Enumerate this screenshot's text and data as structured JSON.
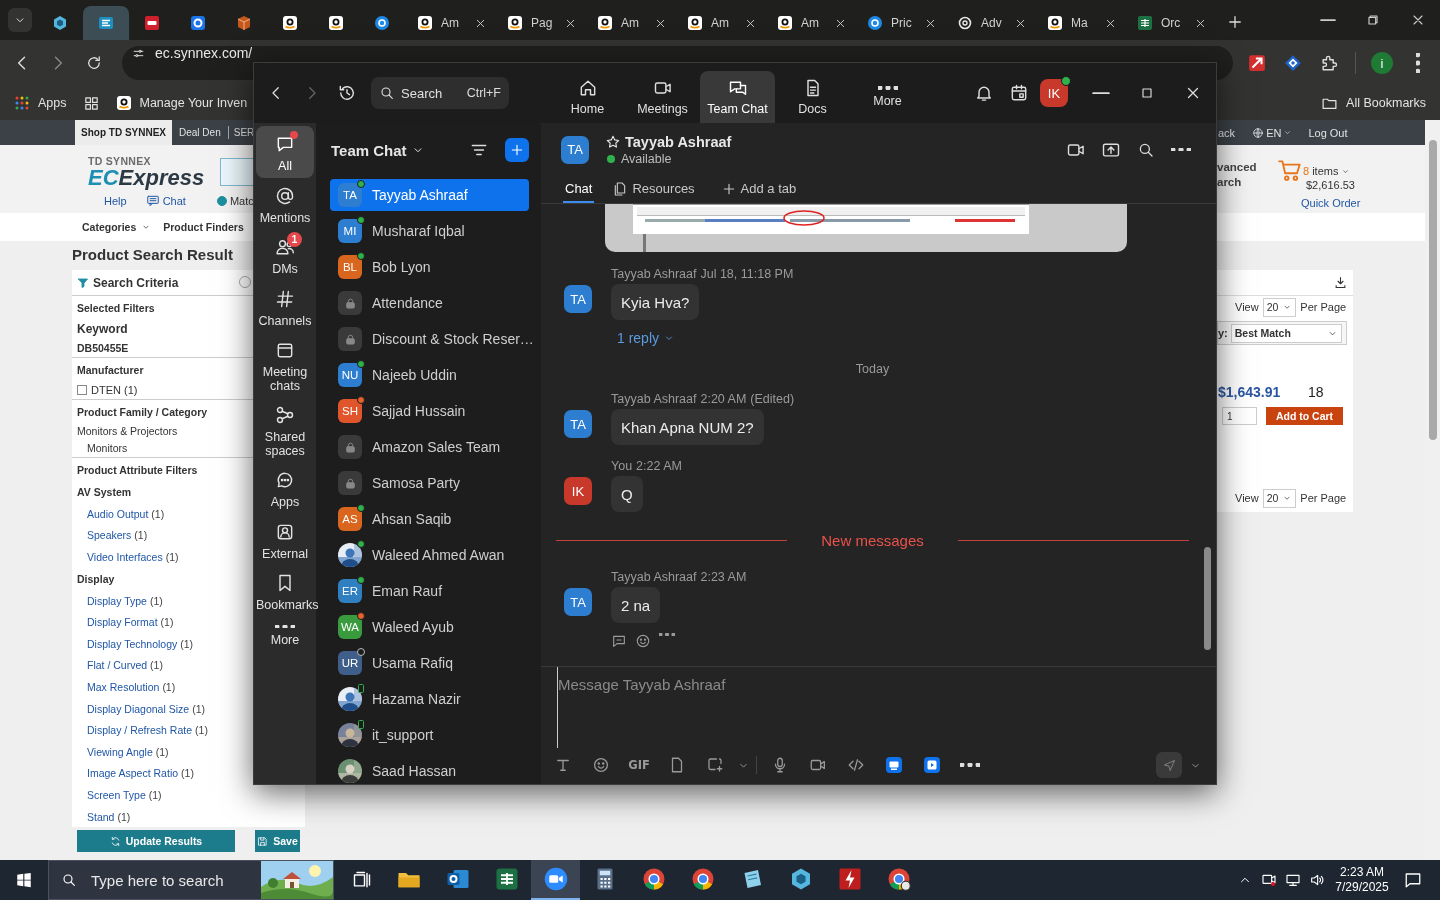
{
  "browser": {
    "tabs": [
      {
        "selected": false
      },
      {
        "selected": true
      },
      {
        "selected": false
      },
      {
        "selected": false
      },
      {
        "selected": false
      },
      {
        "selected": false
      },
      {
        "selected": false
      },
      {
        "selected": false
      },
      {
        "title": "Am",
        "selected": false
      },
      {
        "title": "Pag",
        "selected": false
      },
      {
        "title": "Am",
        "selected": false
      },
      {
        "title": "Am",
        "selected": false
      },
      {
        "title": "Am",
        "selected": false
      },
      {
        "title": "Pric",
        "selected": false
      },
      {
        "title": "Adv",
        "selected": false
      },
      {
        "title": "Ma",
        "selected": false
      },
      {
        "title": "Orc",
        "selected": false
      }
    ],
    "address": "ec.synnex.com/",
    "profile_initial": "i",
    "bookmarks": [
      {
        "kind": "apps",
        "label": "Apps"
      },
      {
        "kind": "grid"
      },
      {
        "kind": "site",
        "label": "Manage Your Inven"
      }
    ],
    "all_bookmarks": "All Bookmarks"
  },
  "web_page": {
    "top_nav": [
      {
        "label": "Shop TD SYNNEX",
        "selected": true
      },
      {
        "label": "Deal Den",
        "selected": false
      },
      {
        "label": "SER",
        "selected": false
      }
    ],
    "top_links": [
      {
        "kind": "text",
        "label": "ack"
      },
      {
        "kind": "language",
        "label": "EN"
      },
      {
        "kind": "text",
        "label": "Log Out"
      }
    ],
    "logo": {
      "small": "TD SYNNEX",
      "accent": "EC",
      "rest": "Express"
    },
    "header_links": [
      {
        "kind": "link",
        "label": "Help"
      },
      {
        "kind": "chat",
        "label": "Chat"
      },
      {
        "kind": "radio",
        "label": "Matc",
        "checked": true
      }
    ],
    "advanced": [
      "vanced",
      "arch"
    ],
    "cart": {
      "count": "8",
      "label": "items",
      "total": "$2,616.53",
      "quick_order": "Quick Order"
    },
    "nav": [
      {
        "kind": "dropdown",
        "label": "Categories"
      },
      {
        "kind": "link",
        "label": "Product Finders"
      }
    ],
    "title": "Product Search Result",
    "criteria": "Search Criteria",
    "filters": [
      {
        "kind": "section",
        "label": "Selected Filters"
      },
      {
        "kind": "heading",
        "label": "Keyword"
      },
      {
        "kind": "value",
        "label": "DB50455E"
      },
      {
        "kind": "section",
        "label": "Manufacturer"
      },
      {
        "kind": "checkbox",
        "label": "DTEN (1)",
        "checked": false
      },
      {
        "kind": "section",
        "label": "Product Family / Category"
      },
      {
        "kind": "text",
        "label": "Monitors & Projectors"
      },
      {
        "kind": "subtext",
        "label": "Monitors"
      },
      {
        "kind": "section",
        "label": "Product Attribute Filters"
      },
      {
        "kind": "group",
        "label": "AV System"
      },
      {
        "kind": "link",
        "label": "Audio Output",
        "count": "(1)"
      },
      {
        "kind": "link",
        "label": "Speakers",
        "count": "(1)"
      },
      {
        "kind": "link",
        "label": "Video Interfaces",
        "count": "(1)"
      },
      {
        "kind": "group",
        "label": "Display"
      },
      {
        "kind": "link",
        "label": "Display Type",
        "count": "(1)"
      },
      {
        "kind": "link",
        "label": "Display Format",
        "count": "(1)"
      },
      {
        "kind": "link",
        "label": "Display Technology",
        "count": "(1)"
      },
      {
        "kind": "link",
        "label": "Flat / Curved",
        "count": "(1)"
      },
      {
        "kind": "link",
        "label": "Max Resolution",
        "count": "(1)"
      },
      {
        "kind": "link",
        "label": "Display Diagonal Size",
        "count": "(1)"
      },
      {
        "kind": "link",
        "label": "Display / Refresh Rate",
        "count": "(1)"
      },
      {
        "kind": "link",
        "label": "Viewing Angle",
        "count": "(1)"
      },
      {
        "kind": "link",
        "label": "Image Aspect Ratio",
        "count": "(1)"
      },
      {
        "kind": "link",
        "label": "Screen Type",
        "count": "(1)"
      },
      {
        "kind": "link",
        "label": "Stand",
        "count": "(1)"
      }
    ],
    "buttons": [
      {
        "kind": "update",
        "label": "Update Results"
      },
      {
        "kind": "save",
        "label": "Save"
      }
    ],
    "results": {
      "view": {
        "label": "View",
        "value": "20",
        "suffix": "Per Page"
      },
      "sort": {
        "label": "y:",
        "value": "Best Match"
      },
      "price": "$1,643.91",
      "stock": "18",
      "quantity": "1",
      "add_to_cart": "Add to Cart",
      "view_bottom": {
        "label": "View",
        "value": "20",
        "suffix": "Per Page"
      }
    }
  },
  "zoom": {
    "search": {
      "placeholder": "Search",
      "shortcut": "Ctrl+F"
    },
    "nav": [
      {
        "label": "Home",
        "selected": false
      },
      {
        "label": "Meetings",
        "selected": false
      },
      {
        "label": "Team Chat",
        "selected": true
      },
      {
        "label": "Docs",
        "selected": false
      },
      {
        "label": "More",
        "selected": false
      }
    ],
    "avatar": {
      "initials": "IK",
      "color": "#c8392b"
    },
    "rail": [
      {
        "label": "All",
        "selected": true,
        "unread": true
      },
      {
        "label": "Mentions",
        "selected": false,
        "unread": false
      },
      {
        "label": "DMs",
        "selected": false,
        "unread": false,
        "badge": "1"
      },
      {
        "label": "Channels",
        "selected": false,
        "unread": false
      },
      {
        "label": "Meeting chats",
        "selected": false,
        "unread": false
      },
      {
        "label": "Shared spaces",
        "selected": false,
        "unread": false
      },
      {
        "label": "Apps",
        "selected": false,
        "unread": false
      },
      {
        "label": "External",
        "selected": false,
        "unread": false
      },
      {
        "label": "Bookmarks",
        "selected": false,
        "unread": false
      },
      {
        "label": "More",
        "selected": false,
        "unread": false
      }
    ],
    "list_title": "Team Chat",
    "chats": [
      {
        "kind": "initials",
        "initials": "TA",
        "color": "#2d7ed1",
        "name": "Tayyab Ashraaf",
        "online": true,
        "busy": false,
        "mobile": false,
        "selected": true
      },
      {
        "kind": "initials",
        "initials": "MI",
        "color": "#2d7ed1",
        "name": "Musharaf Iqbal",
        "online": true,
        "busy": false,
        "mobile": false,
        "selected": false
      },
      {
        "kind": "initials",
        "initials": "BL",
        "color": "#d9661f",
        "name": "Bob Lyon",
        "online": true,
        "busy": false,
        "mobile": false,
        "selected": false
      },
      {
        "kind": "channel",
        "name": "Attendance",
        "selected": false
      },
      {
        "kind": "channel",
        "name": "Discount & Stock Reser…",
        "selected": false
      },
      {
        "kind": "initials",
        "initials": "NU",
        "color": "#2d7ed1",
        "name": "Najeeb Uddin",
        "online": true,
        "busy": false,
        "mobile": false,
        "selected": false
      },
      {
        "kind": "initials",
        "initials": "SH",
        "color": "#e0552b",
        "name": "Sajjad Hussain",
        "online": true,
        "busy": true,
        "mobile": false,
        "selected": false
      },
      {
        "kind": "channel",
        "name": "Amazon Sales Team",
        "selected": false
      },
      {
        "kind": "channel",
        "name": "Samosa Party",
        "selected": false
      },
      {
        "kind": "initials",
        "initials": "AS",
        "color": "#d9661f",
        "name": "Ahsan Saqib",
        "online": true,
        "busy": false,
        "mobile": false,
        "selected": false
      },
      {
        "kind": "picture",
        "name": "Waleed Ahmed Awan",
        "online": true,
        "busy": false,
        "mobile": false,
        "selected": false
      },
      {
        "kind": "initials",
        "initials": "ER",
        "color": "#2f7fc1",
        "name": "Eman Rauf",
        "online": true,
        "busy": false,
        "mobile": false,
        "selected": false
      },
      {
        "kind": "initials",
        "initials": "WA",
        "color": "#3a9a3e",
        "name": "Waleed Ayub",
        "online": true,
        "busy": true,
        "mobile": false,
        "selected": false
      },
      {
        "kind": "initials",
        "initials": "UR",
        "color": "#3f5f8a",
        "name": "Usama Rafiq",
        "online": false,
        "busy": false,
        "mobile": false,
        "selected": false
      },
      {
        "kind": "picture",
        "name": "Hazama Nazir",
        "online": true,
        "busy": false,
        "mobile": true,
        "selected": false
      },
      {
        "kind": "picture",
        "name": "it_support",
        "online": true,
        "busy": false,
        "mobile": true,
        "selected": false
      },
      {
        "kind": "picture",
        "name": "Saad Hassan",
        "selected": false
      }
    ],
    "conversation": {
      "initials": "TA",
      "color": "#2d7ed1",
      "name": "Tayyab Ashraaf",
      "status": "Available",
      "tabs": [
        {
          "label": "Chat",
          "selected": true
        },
        {
          "label": "Resources",
          "selected": false
        },
        {
          "label": "Add a tab",
          "selected": false
        }
      ],
      "messages": [
        {
          "kind": "picture"
        },
        {
          "kind": "message",
          "initials": "TA",
          "color": "#2d7ed1",
          "sender": "Tayyab Ashraaf",
          "time": "Jul 18, 11:18 PM",
          "text": "Kyia Hva?",
          "replies": "1 reply",
          "actions": false
        },
        {
          "kind": "divider",
          "label": "Today"
        },
        {
          "kind": "message",
          "initials": "TA",
          "color": "#2d7ed1",
          "sender": "Tayyab Ashraaf",
          "time": "2:20 AM",
          "edited": "(Edited)",
          "text": "Khan Apna NUM 2?",
          "actions": false
        },
        {
          "kind": "message",
          "initials": "IK",
          "color": "#c8392b",
          "sender": "You",
          "time": "2:22 AM",
          "text": "Q",
          "actions": false
        },
        {
          "kind": "new_divider",
          "label": "New messages"
        },
        {
          "kind": "message",
          "initials": "TA",
          "color": "#2d7ed1",
          "sender": "Tayyab Ashraaf",
          "time": "2:23 AM",
          "text": "2 na",
          "actions": true
        }
      ],
      "composer": {
        "placeholder": "Message Tayyab Ashraaf",
        "gif": "GIF"
      }
    }
  },
  "taskbar": {
    "search": {
      "placeholder": "Type here to search"
    },
    "apps": [
      {
        "selected": false
      },
      {
        "selected": false
      },
      {
        "selected": false
      },
      {
        "selected": true
      },
      {
        "selected": false
      },
      {
        "selected": false
      },
      {
        "selected": false
      },
      {
        "selected": false
      },
      {
        "selected": false
      },
      {
        "selected": false
      },
      {
        "selected": false
      }
    ],
    "time": "2:23 AM",
    "date": "7/29/2025"
  }
}
